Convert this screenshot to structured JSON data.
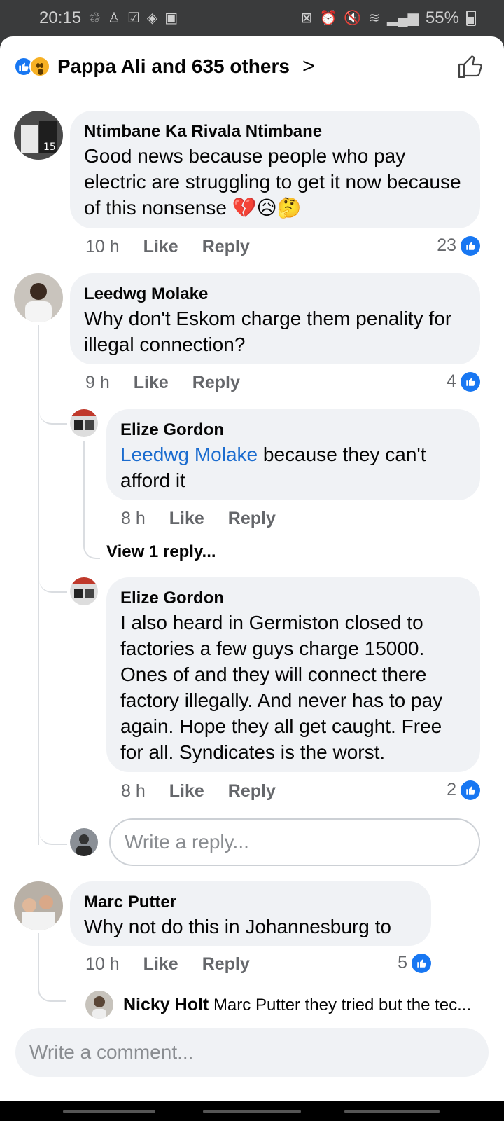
{
  "status_bar": {
    "time": "20:15",
    "left_icons": [
      "recycle-icon",
      "person-icon",
      "checkbox-icon",
      "direction-icon",
      "image-icon"
    ],
    "right_icons": [
      "alarm-lock-icon",
      "alarm-icon",
      "mute-icon",
      "wifi-icon",
      "signal-icon"
    ],
    "battery": "55%"
  },
  "header": {
    "reactions_text": "Pappa Ali and 635 others",
    "reaction_icons": [
      "like-reaction-icon",
      "wow-reaction-icon"
    ],
    "accent": "#1877f2"
  },
  "comments": [
    {
      "author": "Ntimbane Ka Rivala Ntimbane",
      "text": "Good news because people who pay electric are struggling to get it now because of this nonsense 💔😥🤔",
      "time": "10 h",
      "like_label": "Like",
      "reply_label": "Reply",
      "likes": "23"
    },
    {
      "author": "Leedwg Molake",
      "text": "Why don't Eskom charge them penality for illegal connection?",
      "time": "9 h",
      "like_label": "Like",
      "reply_label": "Reply",
      "likes": "4"
    },
    {
      "author": "Elize Gordon",
      "mention": "Leedwg Molake",
      "text": " because they can't afford it",
      "time": "8 h",
      "like_label": "Like",
      "reply_label": "Reply"
    },
    {
      "author": "Elize Gordon",
      "text": "I also heard in Germiston closed to factories a few guys charge 15000. Ones of and they will connect there factory illegally. And never has to pay again. Hope they all get caught. Free for all. Syndicates is the worst.",
      "time": "8 h",
      "like_label": "Like",
      "reply_label": "Reply",
      "likes": "2"
    },
    {
      "author": "Marc Putter",
      "text": "Why not do this in Johannesburg to",
      "time": "10 h",
      "like_label": "Like",
      "reply_label": "Reply",
      "likes": "5"
    }
  ],
  "view_replies": "View 1 reply...",
  "reply_placeholder": "Write a reply...",
  "nicky": {
    "author": "Nicky Holt",
    "text": "Marc Putter they tried but the tec..."
  },
  "comment_placeholder": "Write a comment..."
}
